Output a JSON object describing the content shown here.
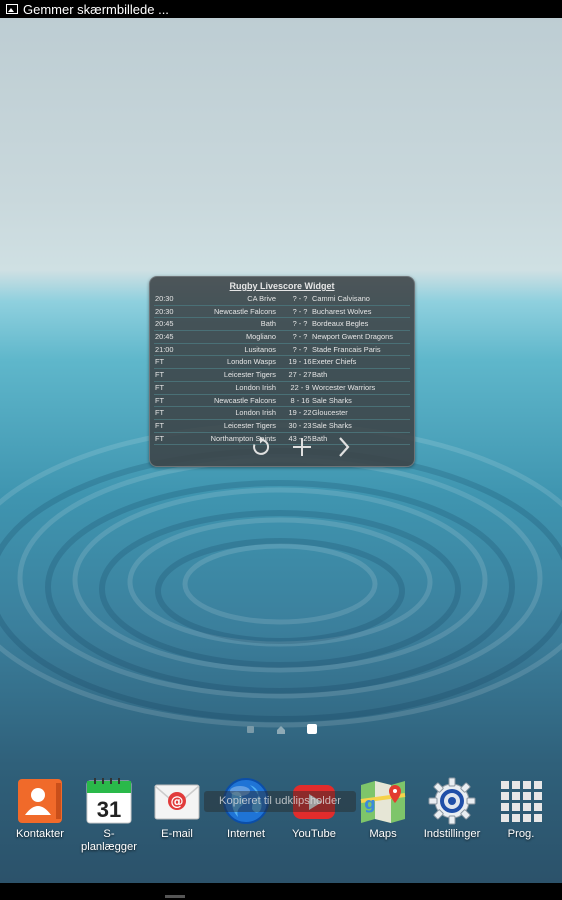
{
  "status_bar": {
    "notification_icon": "image-icon",
    "notification_text": "Gemmer skærmbillede ..."
  },
  "widget": {
    "title": "Rugby Livescore Widget",
    "matches": [
      {
        "time": "20:30",
        "home": "CA Brive",
        "score": "? - ?",
        "away": "Cammi Calvisano"
      },
      {
        "time": "20:30",
        "home": "Newcastle Falcons",
        "score": "? - ?",
        "away": "Bucharest Wolves"
      },
      {
        "time": "20:45",
        "home": "Bath",
        "score": "? - ?",
        "away": "Bordeaux Begles"
      },
      {
        "time": "20:45",
        "home": "Mogliano",
        "score": "? - ?",
        "away": "Newport Gwent Dragons"
      },
      {
        "time": "21:00",
        "home": "Lusitanos",
        "score": "? - ?",
        "away": "Stade Francais Paris"
      },
      {
        "time": "FT",
        "home": "London Wasps",
        "score": "19 - 16",
        "away": "Exeter Chiefs"
      },
      {
        "time": "FT",
        "home": "Leicester Tigers",
        "score": "27 - 27",
        "away": "Bath"
      },
      {
        "time": "FT",
        "home": "London Irish",
        "score": "22 - 9",
        "away": "Worcester Warriors"
      },
      {
        "time": "FT",
        "home": "Newcastle Falcons",
        "score": "8 - 16",
        "away": "Sale Sharks"
      },
      {
        "time": "FT",
        "home": "London Irish",
        "score": "19 - 22",
        "away": "Gloucester"
      },
      {
        "time": "FT",
        "home": "Leicester Tigers",
        "score": "30 - 23",
        "away": "Sale Sharks"
      },
      {
        "time": "FT",
        "home": "Northampton Saints",
        "score": "43 - 25",
        "away": "Bath"
      }
    ],
    "controls": [
      "refresh-icon",
      "plus-icon",
      "chevron-right-icon"
    ]
  },
  "pager": {
    "pages": 3,
    "home_page": 2,
    "active_page": 3
  },
  "toast": "Kopieret til udklipsholder",
  "dock": [
    {
      "label": "Kontakter",
      "icon": "contacts-icon"
    },
    {
      "label": "S-\nplanlægger",
      "icon": "calendar-icon",
      "badge": "31"
    },
    {
      "label": "E-mail",
      "icon": "email-icon"
    },
    {
      "label": "Internet",
      "icon": "globe-icon"
    },
    {
      "label": "YouTube",
      "icon": "youtube-icon"
    },
    {
      "label": "Maps",
      "icon": "maps-icon"
    },
    {
      "label": "Indstillinger",
      "icon": "gear-icon"
    },
    {
      "label": "Prog.",
      "icon": "apps-grid-icon"
    }
  ],
  "colors": {
    "widget_bg": "#3c4246",
    "accent_green": "#2ab94a",
    "contacts_orange": "#f06a2a",
    "youtube_red": "#e12c2c"
  }
}
